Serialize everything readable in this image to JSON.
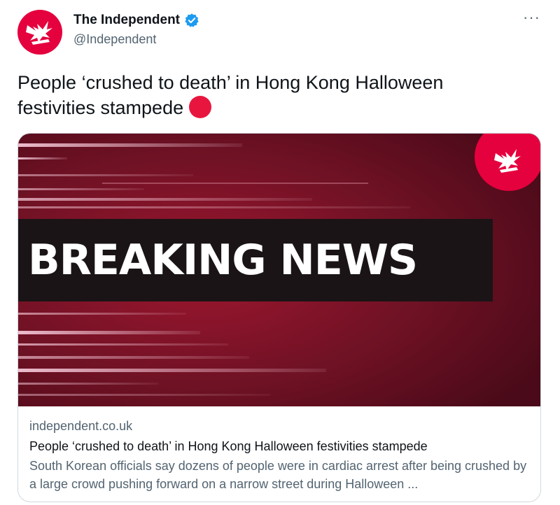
{
  "tweet": {
    "display_name": "The Independent",
    "handle": "@Independent",
    "text": "People ‘crushed to death’ in Hong Kong Halloween festivities stampede",
    "more_label": "···",
    "icons": {
      "avatar": "independent-eagle-logo",
      "verified": "verified-badge-icon",
      "emoji": "red-circle-emoji"
    }
  },
  "card": {
    "image_text": "BREAKING NEWS",
    "domain": "independent.co.uk",
    "title": "People ‘crushed to death’ in Hong Kong Halloween festivities stampede",
    "description": "South Korean officials say dozens of people were in cardiac arrest after being crushed by a large crowd pushing forward on a narrow street during Halloween ..."
  },
  "colors": {
    "brand_red": "#e5003e",
    "verified_blue": "#1d9bf0",
    "image_dark_red": "#5a0d1e",
    "text_gray": "#536471"
  }
}
